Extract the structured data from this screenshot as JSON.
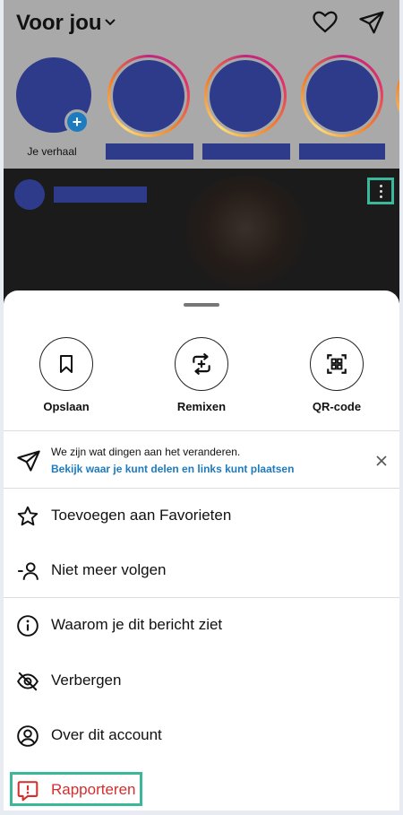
{
  "app": {
    "title": "Voor jou"
  },
  "stories": {
    "own_label": "Je verhaal",
    "add_symbol": "+"
  },
  "share_actions": [
    {
      "label": "Opslaan",
      "icon": "bookmark-icon"
    },
    {
      "label": "Remixen",
      "icon": "remix-icon"
    },
    {
      "label": "QR-code",
      "icon": "qr-code-icon"
    }
  ],
  "notice": {
    "title": "We zijn wat dingen aan het veranderen.",
    "link": "Bekijk waar je kunt delen en links kunt plaatsen"
  },
  "menu": {
    "favorites": "Toevoegen aan Favorieten",
    "unfollow": "Niet meer volgen",
    "why": "Waarom je dit bericht ziet",
    "hide": "Verbergen",
    "about": "Over dit account",
    "report": "Rapporteren"
  },
  "colors": {
    "accent_blue": "#1d7bbf",
    "report_red": "#d32f2f",
    "highlight": "#3bb89a",
    "placeholder": "#2e3b8b"
  }
}
